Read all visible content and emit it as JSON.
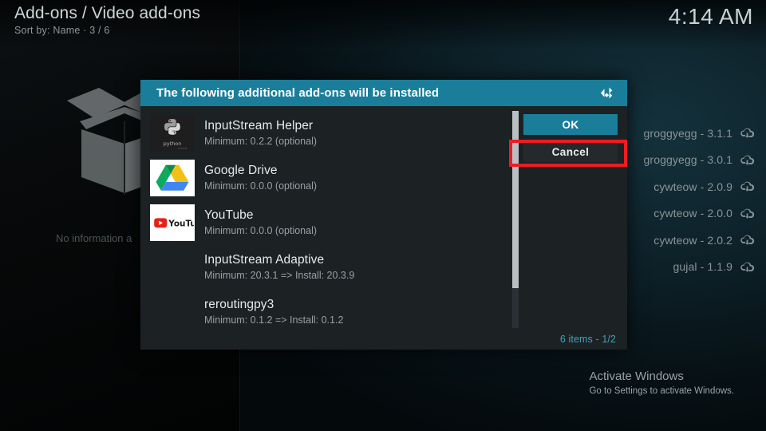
{
  "header": {
    "title": "Add-ons / Video add-ons",
    "subtitle": "Sort by: Name  ·  3 / 6",
    "clock": "4:14 AM"
  },
  "left_panel": {
    "placeholder_icon": "open-box-icon",
    "no_info_text": "No information a"
  },
  "background_list": {
    "items": [
      {
        "label": "groggyegg - 3.1.1",
        "icon": "cloud-download-icon"
      },
      {
        "label": "groggyegg - 3.0.1",
        "icon": "cloud-download-icon"
      },
      {
        "label": "cywteow - 2.0.9",
        "icon": "cloud-download-icon"
      },
      {
        "label": "cywteow - 2.0.0",
        "icon": "cloud-download-icon"
      },
      {
        "label": "cywteow - 2.0.2",
        "icon": "cloud-download-icon"
      },
      {
        "label": "gujal - 1.1.9",
        "icon": "cloud-download-icon"
      }
    ]
  },
  "dialog": {
    "title": "The following additional add-ons will be installed",
    "logo_icon": "kodi-logo-icon",
    "addons": [
      {
        "name": "InputStream Helper",
        "meta": "Minimum: 0.2.2 (optional)",
        "icon": "python-logo-icon"
      },
      {
        "name": "Google Drive",
        "meta": "Minimum: 0.0.0 (optional)",
        "icon": "google-drive-logo-icon"
      },
      {
        "name": "YouTube",
        "meta": "Minimum: 0.0.0 (optional)",
        "icon": "youtube-logo-icon"
      },
      {
        "name": "InputStream Adaptive",
        "meta": "Minimum: 20.3.1 => Install: 20.3.9",
        "icon": "none"
      },
      {
        "name": "reroutingpy3",
        "meta": "Minimum: 0.1.2 => Install: 0.1.2",
        "icon": "none"
      }
    ],
    "buttons": {
      "ok": "OK",
      "cancel": "Cancel"
    },
    "footer": {
      "count": "6 items",
      "separator": " - ",
      "page": "1/2"
    }
  },
  "watermark": {
    "line1": "Activate Windows",
    "line2": "Go to Settings to activate Windows."
  },
  "colors": {
    "accent_teal": "#1a7e9b",
    "annotation_red": "#ee1b24",
    "dialog_bg": "#1c2124",
    "footer_accent": "#3fa3bd"
  }
}
